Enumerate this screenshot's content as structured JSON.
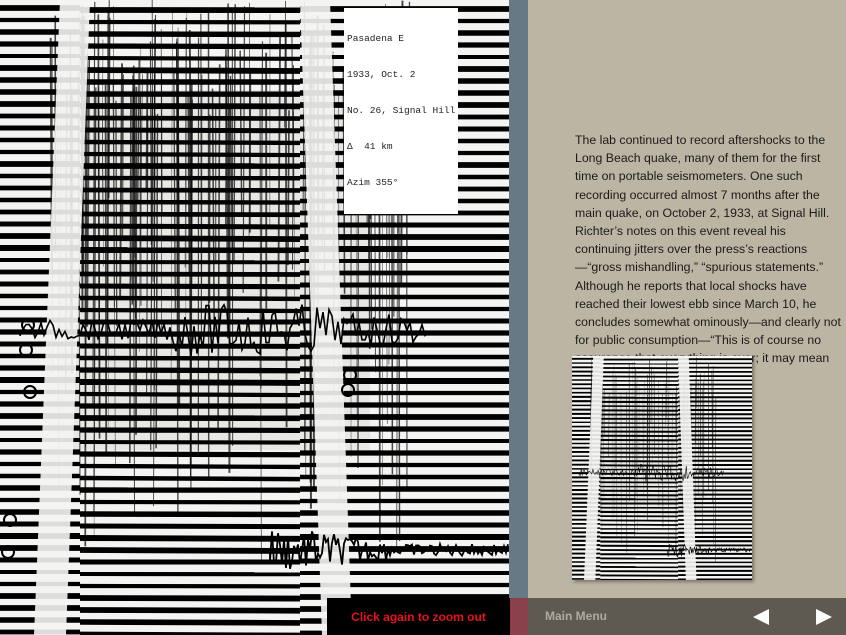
{
  "seismogram": {
    "stamp_lines": [
      "Pasadena E",
      "1933, Oct. 2",
      "No. 26, Signal Hill",
      "Δ  41 km",
      "Azim 355°"
    ]
  },
  "story": {
    "text": "The lab continued to record aftershocks to the Long Beach quake, many of them for the first time on portable seismometers. One such recording occurred almost 7 months after the main quake, on October 2, 1933, at Signal Hill. Richter’s notes on this event reveal his continuing jitters over the press’s reactions—“gross mishandling,” “spurious statements.” Although he reports that local shocks have reached their lowest ebb since March 10, he concludes somewhat ominously—and clearly not for public consumption—“This is of course no assurance that everything is over; it may mean the reverse.”"
  },
  "zoom": {
    "label": "Click again to zoom out"
  },
  "nav": {
    "main_menu": "Main Menu",
    "prev_icon": "left-triangle",
    "next_icon": "right-triangle"
  },
  "colors": {
    "panel_bg": "#bdb5a3",
    "divider": "#677984",
    "bottom_bar": "#5e5a52",
    "zoom_text": "#e8101e",
    "red_strip": "#8a4048"
  }
}
